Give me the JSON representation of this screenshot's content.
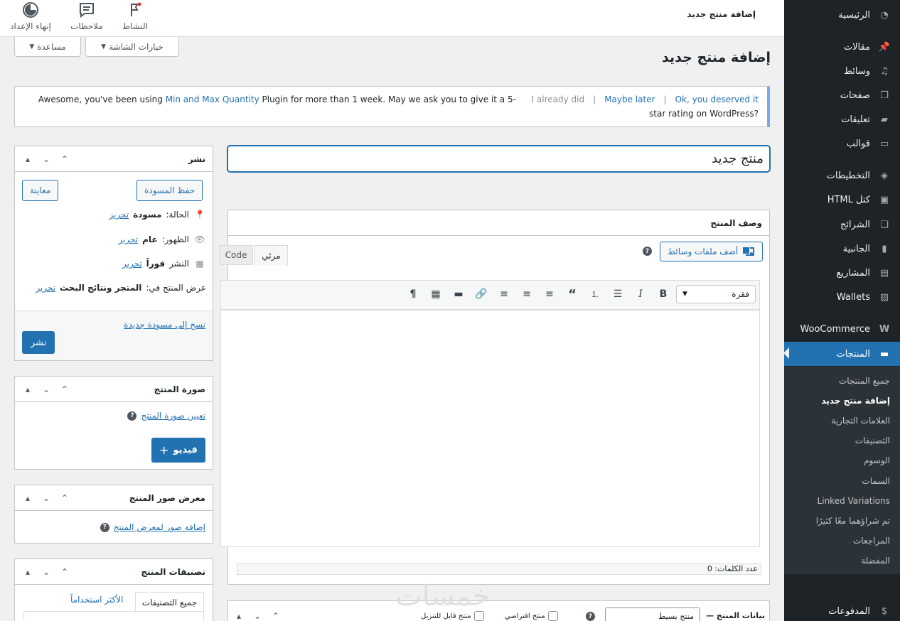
{
  "topbar": {
    "title": "إضافة منتج جديد",
    "activity": "النشاط",
    "notes": "ملاحظات",
    "finish_setup": "إنهاء الإعداد"
  },
  "screen": {
    "options": "خيارات الشاشة",
    "help": "مساعدة"
  },
  "page_title": "إضافة منتج جديد",
  "notice": {
    "text_before": "Awesome, you've been using ",
    "plugin": "Min and Max Quantity",
    "text_after": " Plugin for more than 1 week. May we ask you to give it a 5-star rating on WordPress?",
    "ok": "Ok, you deserved it",
    "later": "Maybe later",
    "already": "I already did"
  },
  "title_input": {
    "value": "منتج جديد"
  },
  "description": {
    "title": "وصف المنتج",
    "add_media": "أضف ملفات وسائط",
    "tab_visual": "مرئي",
    "tab_code": "Code",
    "format": "فقرة",
    "word_count": "عدد الكلمات: 0"
  },
  "product_data": {
    "title": "بيانات المنتج —",
    "type": "منتج بسيط",
    "virtual": "منتج افتراضي",
    "downloadable": "منتج قابل للتنزيل"
  },
  "publish": {
    "title": "نشر",
    "save_draft": "حفظ المسودة",
    "preview": "معاينة",
    "status_label": "الحالة:",
    "status_value": "مسودة",
    "visibility_label": "الظهور:",
    "visibility_value": "عام",
    "schedule_label": "النشر",
    "schedule_value": "فوراً",
    "catalog_label": "عرض المنتج في:",
    "catalog_value": "المتجر ونتائج البحث",
    "edit": "تحرير",
    "copy_draft": "نسخ إلى مسودة جديدة",
    "publish_btn": "نشر"
  },
  "product_image": {
    "title": "صورة المنتج",
    "set_image": "تعيين صورة المنتج",
    "video_btn": "فيديو"
  },
  "gallery": {
    "title": "معرض صور المنتج",
    "add": "إضافة صور لمعرض المنتج"
  },
  "categories": {
    "title": "تصنيفات المنتج",
    "tab_all": "جميع التصنيفات",
    "tab_popular": "الأكثر استخداماً"
  },
  "sidebar": {
    "items": [
      {
        "label": "الرئيسية",
        "icon": "dashboard-icon"
      },
      {
        "label": "مقالات",
        "icon": "pin-icon"
      },
      {
        "label": "وسائط",
        "icon": "media-icon"
      },
      {
        "label": "صفحات",
        "icon": "pages-icon"
      },
      {
        "label": "تعليقات",
        "icon": "comments-icon"
      },
      {
        "label": "قوالب",
        "icon": "folder-icon"
      },
      {
        "label": "التخطيطات",
        "icon": "layers-icon"
      },
      {
        "label": "كتل HTML",
        "icon": "code-icon"
      },
      {
        "label": "الشرائح",
        "icon": "slides-icon"
      },
      {
        "label": "الجانبية",
        "icon": "sidebar-icon"
      },
      {
        "label": "المشاريع",
        "icon": "briefcase-icon"
      },
      {
        "label": "Wallets",
        "icon": "wallet-icon"
      },
      {
        "label": "WooCommerce",
        "icon": "woo-icon"
      },
      {
        "label": "المنتجات",
        "icon": "archive-icon"
      },
      {
        "label": "المدفوعات",
        "icon": "dollar-icon"
      }
    ],
    "submenu": [
      "جميع المنتجات",
      "إضافة منتج جديد",
      "العلامات التجارية",
      "التصنيفات",
      "الوسوم",
      "السمات",
      "Linked Variations",
      "تم شراؤهما معًا كثيرًا",
      "المراجعات",
      "المفضلة"
    ]
  },
  "watermark": "خمسات",
  "colors": {
    "accent": "#2271b1",
    "sidebar_bg": "#1d2327",
    "notice_border": "#72aee6"
  }
}
